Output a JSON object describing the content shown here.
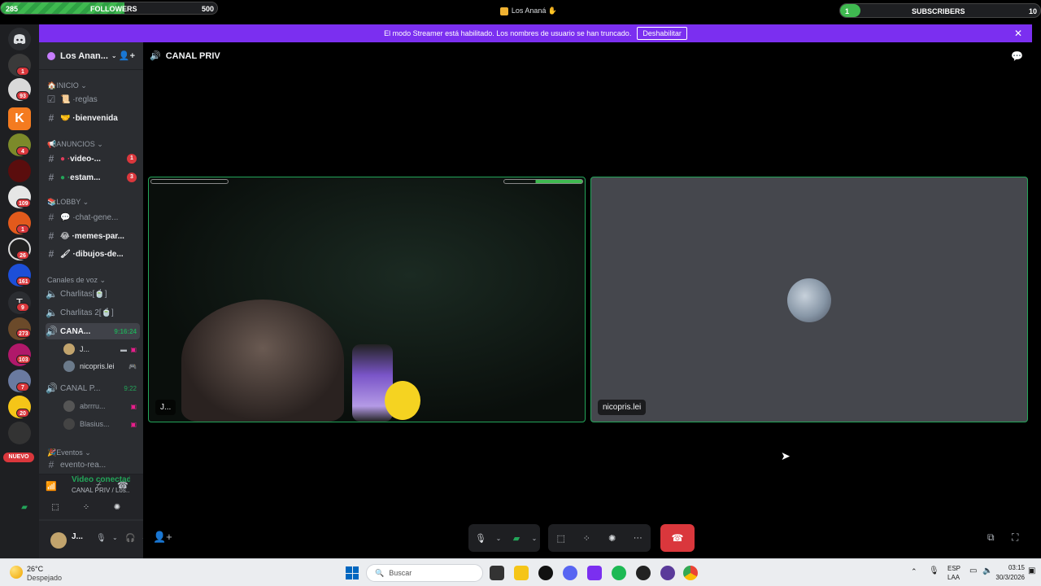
{
  "overlay": {
    "followers": {
      "start": "285",
      "label": "FOLLOWERS",
      "goal": "500",
      "progress": 0.57
    },
    "subscribers": {
      "current": "1",
      "label": "SUBSCRIBERS",
      "goal": "10",
      "progress": 0.1
    }
  },
  "window": {
    "title": "Los Ananá"
  },
  "banner": {
    "text": "El modo Streamer está habilitado. Los nombres de usuario se han truncado.",
    "button": "Deshabilitar"
  },
  "server_rail": {
    "badges": [
      "1",
      "93",
      "4",
      "109",
      "1",
      "26",
      "161",
      "9",
      "273",
      "103",
      "7",
      "20"
    ],
    "nuevo_label": "NUEVO"
  },
  "sidebar": {
    "server_name": "Los Anan...",
    "categories": {
      "inicio": "INICIO",
      "anuncios": "ANUNCIOS",
      "lobby": "LOBBY",
      "voz": "Canales de voz",
      "eventos": "Eventos"
    },
    "channels": [
      {
        "name": "reglas"
      },
      {
        "name": "bienvenida"
      },
      {
        "name": "video-...",
        "badge": "1"
      },
      {
        "name": "estam...",
        "badge": "3"
      },
      {
        "name": "chat-gene..."
      },
      {
        "name": "memes-par..."
      },
      {
        "name": "dibujos-de..."
      },
      {
        "name": "evento-rea..."
      }
    ],
    "voice_channels": [
      {
        "name": "Charlitas[🍵]"
      },
      {
        "name": "Charlitas 2[🍵]"
      },
      {
        "name": "CANA...",
        "time": "9:16:24"
      },
      {
        "name": "CANAL P...",
        "time": "9:22"
      }
    ],
    "voice_users": [
      "J...",
      "nicopris.lei",
      "abrrru...",
      "Blasius..."
    ]
  },
  "voice_panel": {
    "status": "Video conectad",
    "location": "CANAL PRIV / Los..."
  },
  "user_panel": {
    "name": "J..."
  },
  "stage": {
    "channel_name": "CANAL PRIV",
    "tiles": [
      {
        "label": "J..."
      },
      {
        "label": "nicopris.lei"
      }
    ]
  },
  "taskbar": {
    "weather_temp": "26°C",
    "weather_desc": "Despejado",
    "search_placeholder": "Buscar",
    "lang_top": "ESP",
    "lang_bottom": "LAA",
    "time": "03:15",
    "date": "30/3/2026"
  },
  "colors": {
    "accent_green": "#23a559",
    "banner_purple": "#7b2ff0",
    "badge_red": "#da373c",
    "hangup_red": "#da373c"
  }
}
